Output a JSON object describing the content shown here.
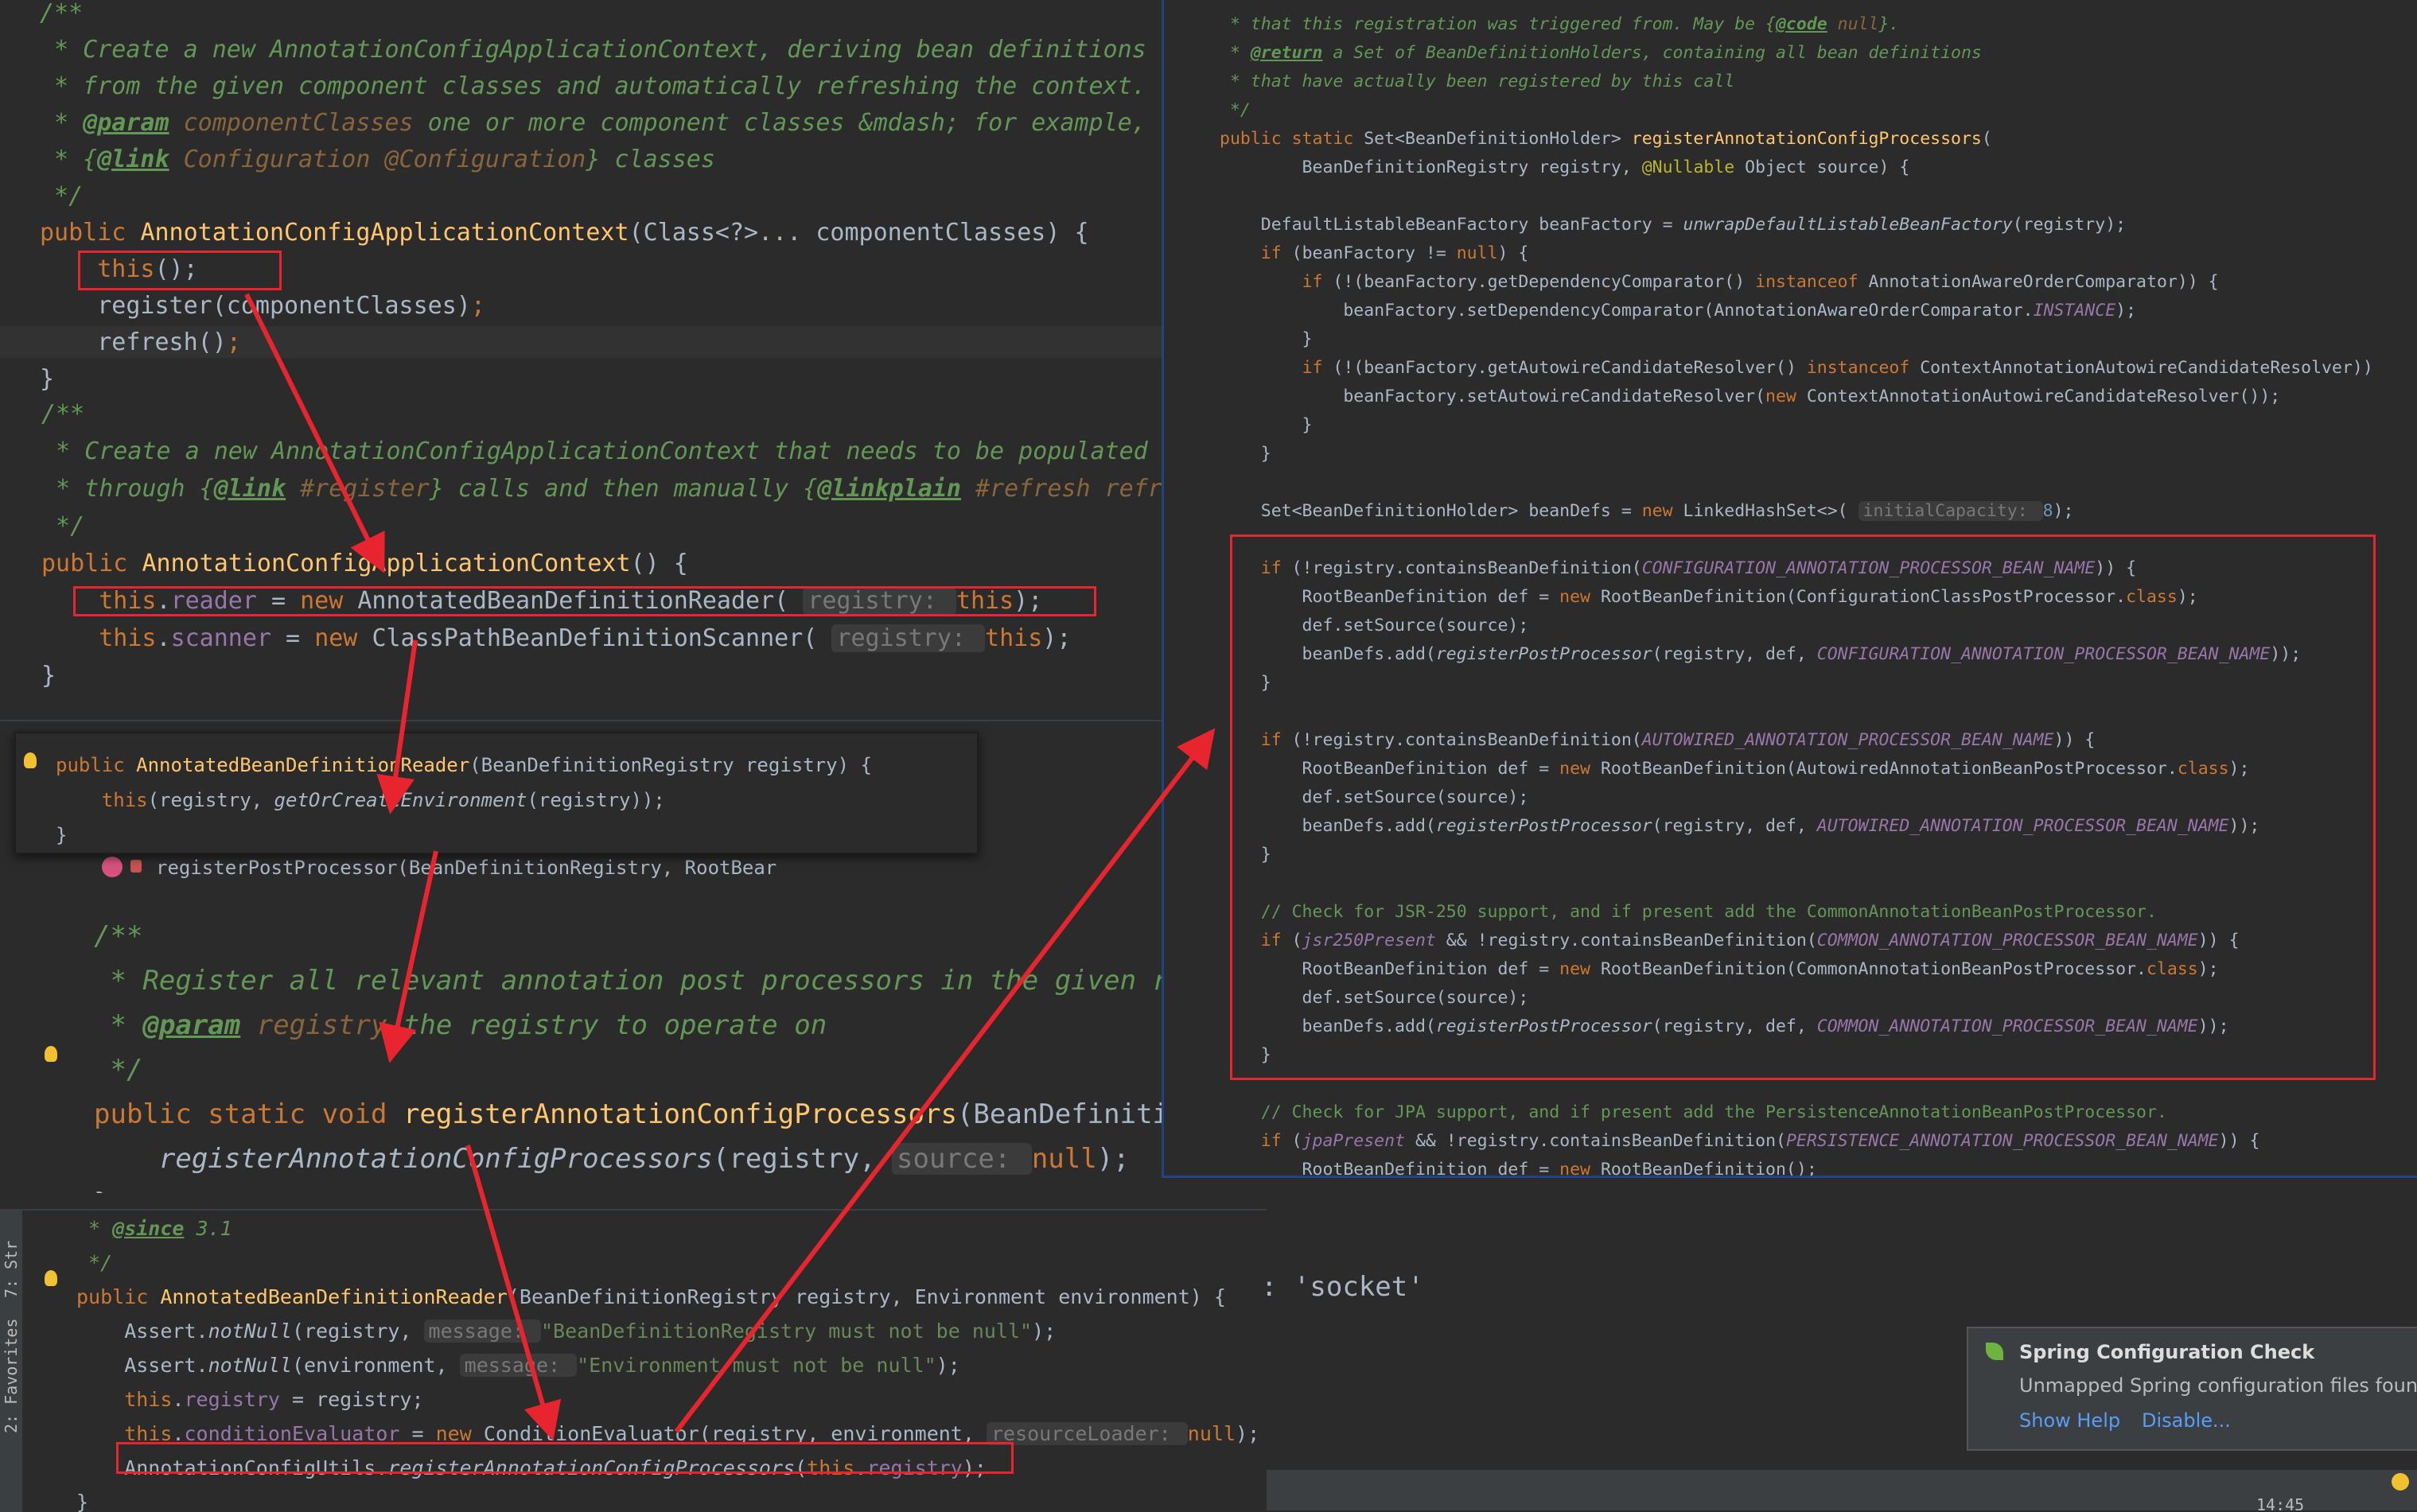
{
  "panel_a": {
    "lines": [
      [
        [
          "/**",
          "c"
        ]
      ],
      [
        [
          " * Create a new AnnotationConfigApplicationContext, deriving bean definitions",
          "c"
        ]
      ],
      [
        [
          " * from the given component classes and automatically refreshing the context.",
          "c"
        ]
      ],
      [
        [
          " * ",
          "c"
        ],
        [
          "@param",
          "ct"
        ],
        [
          " componentClasses",
          "ctag"
        ],
        [
          " one or more component classes &mdash; for example,",
          "c"
        ]
      ],
      [
        [
          " * {",
          "c"
        ],
        [
          "@link",
          "ct"
        ],
        [
          " Configuration @Configuration",
          "ctag"
        ],
        [
          "} classes",
          "c"
        ]
      ],
      [
        [
          " */",
          "c"
        ]
      ],
      [
        [
          "public ",
          "kw"
        ],
        [
          "AnnotationConfigApplicationContext",
          "fn"
        ],
        [
          "(Class<?>... componentClasses) {",
          ""
        ]
      ],
      [
        [
          "    ",
          ""
        ],
        [
          "this",
          "kw"
        ],
        [
          "();",
          ""
        ]
      ],
      [
        [
          "    register(componentClasses)",
          ""
        ],
        [
          ";",
          "kw"
        ]
      ],
      [
        [
          "    refresh()",
          ""
        ],
        [
          ";",
          "kw"
        ]
      ],
      [
        [
          "}",
          ""
        ]
      ]
    ]
  },
  "panel_b": {
    "lines": [
      [
        [
          "/**",
          "c"
        ]
      ],
      [
        [
          " * Create a new AnnotationConfigApplicationContext that needs to be populated",
          "c"
        ]
      ],
      [
        [
          " * through {",
          "c"
        ],
        [
          "@link",
          "ct"
        ],
        [
          " #register",
          "ctag"
        ],
        [
          "} calls and then manually {",
          "c"
        ],
        [
          "@linkplain",
          "ct"
        ],
        [
          " #refresh refr",
          "ctag"
        ]
      ],
      [
        [
          " */",
          "c"
        ]
      ],
      [
        [
          "public ",
          "kw"
        ],
        [
          "AnnotationConfigApplicationContext",
          "fn"
        ],
        [
          "() {",
          ""
        ]
      ],
      [
        [
          "    ",
          ""
        ],
        [
          "this",
          "kw"
        ],
        [
          ".",
          ""
        ],
        [
          "reader",
          "fld"
        ],
        [
          " = ",
          ""
        ],
        [
          "new ",
          "kw"
        ],
        [
          "AnnotatedBeanDefinitionReader( ",
          ""
        ],
        [
          "registry: ",
          "hint"
        ],
        [
          "this",
          "kw"
        ],
        [
          ");",
          ""
        ]
      ],
      [
        [
          "    ",
          ""
        ],
        [
          "this",
          "kw"
        ],
        [
          ".",
          ""
        ],
        [
          "scanner",
          "fld"
        ],
        [
          " = ",
          ""
        ],
        [
          "new ",
          "kw"
        ],
        [
          "ClassPathBeanDefinitionScanner( ",
          ""
        ],
        [
          "registry: ",
          "hint"
        ],
        [
          "this",
          "kw"
        ],
        [
          ");",
          ""
        ]
      ],
      [
        [
          "}",
          ""
        ]
      ]
    ]
  },
  "panel_c": {
    "lines": [
      [
        [
          "public ",
          "kw"
        ],
        [
          "AnnotatedBeanDefinitionReader",
          "fn"
        ],
        [
          "(BeanDefinitionRegistry registry) {",
          ""
        ]
      ],
      [
        [
          "    ",
          ""
        ],
        [
          "this",
          "kw"
        ],
        [
          "(registry, ",
          ""
        ],
        [
          "getOrCreateEnvironment",
          "ital"
        ],
        [
          "(registry));",
          ""
        ]
      ],
      [
        [
          "}",
          ""
        ]
      ]
    ],
    "structure_item": "registerPostProcessor(BeanDefinitionRegistry, RootBear"
  },
  "panel_d": {
    "lines": [
      [
        [
          "/**",
          "c"
        ]
      ],
      [
        [
          " * Register all relevant annotation post processors in the given re",
          "c"
        ]
      ],
      [
        [
          " * ",
          "c"
        ],
        [
          "@param",
          "ct"
        ],
        [
          " registry",
          "ctag"
        ],
        [
          " the registry to operate on",
          "c"
        ]
      ],
      [
        [
          " */",
          "c"
        ]
      ],
      [
        [
          "public static void ",
          "kw"
        ],
        [
          "registerAnnotationConfigProcessors",
          "fn"
        ],
        [
          "(BeanDefinitio",
          ""
        ]
      ],
      [
        [
          "    ",
          ""
        ],
        [
          "registerAnnotationConfigProcessors",
          "ital"
        ],
        [
          "(registry, ",
          ""
        ],
        [
          "source: ",
          "hint"
        ],
        [
          "null",
          "kw"
        ],
        [
          ");",
          ""
        ]
      ],
      [
        [
          "}",
          ""
        ]
      ]
    ]
  },
  "panel_e": {
    "lines": [
      [
        [
          " * ",
          "c"
        ],
        [
          "@since",
          "ct"
        ],
        [
          " 3.1",
          "c"
        ]
      ],
      [
        [
          " */",
          "c"
        ]
      ],
      [
        [
          "public ",
          "kw"
        ],
        [
          "AnnotatedBeanDefinitionReader",
          "fn"
        ],
        [
          "(BeanDefinitionRegistry registry, Environment environment) {",
          ""
        ]
      ],
      [
        [
          "    Assert.",
          ""
        ],
        [
          "notNull",
          "ital"
        ],
        [
          "(registry, ",
          ""
        ],
        [
          "message: ",
          "hint"
        ],
        [
          "\"BeanDefinitionRegistry must not be null\"",
          "str"
        ],
        [
          ");",
          ""
        ]
      ],
      [
        [
          "    Assert.",
          ""
        ],
        [
          "notNull",
          "ital"
        ],
        [
          "(environment, ",
          ""
        ],
        [
          "message: ",
          "hint"
        ],
        [
          "\"Environment must not be null\"",
          "str"
        ],
        [
          ");",
          ""
        ]
      ],
      [
        [
          "    ",
          ""
        ],
        [
          "this",
          "kw"
        ],
        [
          ".",
          ""
        ],
        [
          "registry",
          "fld"
        ],
        [
          " = registry;",
          ""
        ]
      ],
      [
        [
          "    ",
          ""
        ],
        [
          "this",
          "kw"
        ],
        [
          ".",
          ""
        ],
        [
          "conditionEvaluator",
          "fld"
        ],
        [
          " = ",
          ""
        ],
        [
          "new ",
          "kw"
        ],
        [
          "ConditionEvaluator(registry, environment, ",
          ""
        ],
        [
          "resourceLoader: ",
          "hint"
        ],
        [
          "null",
          "kw"
        ],
        [
          ");",
          ""
        ]
      ],
      [
        [
          "    AnnotationConfigUtils.",
          ""
        ],
        [
          "registerAnnotationConfigProcessors",
          "ital"
        ],
        [
          "(",
          ""
        ],
        [
          "this",
          "kw"
        ],
        [
          ".",
          ""
        ],
        [
          "registry",
          "fld"
        ],
        [
          ");",
          ""
        ]
      ],
      [
        [
          "}",
          ""
        ]
      ]
    ]
  },
  "panel_f": {
    "lines": [
      [
        [
          " * that this registration was triggered from. May be {",
          "c"
        ],
        [
          "@code",
          "ct"
        ],
        [
          " null",
          "ctag"
        ],
        [
          "}.",
          "c"
        ]
      ],
      [
        [
          " * ",
          "c"
        ],
        [
          "@return",
          "ct"
        ],
        [
          " a Set of BeanDefinitionHolders, containing all bean definitions",
          "c"
        ]
      ],
      [
        [
          " * that have actually been registered by this call",
          "c"
        ]
      ],
      [
        [
          " */",
          "c"
        ]
      ],
      [
        [
          "public static ",
          "kw"
        ],
        [
          "Set<BeanDefinitionHolder> ",
          ""
        ],
        [
          "registerAnnotationConfigProcessors",
          "fn"
        ],
        [
          "(",
          ""
        ]
      ],
      [
        [
          "        BeanDefinitionRegistry registry, ",
          ""
        ],
        [
          "@Nullable ",
          "ann"
        ],
        [
          "Object source) {",
          ""
        ]
      ],
      [
        [
          "",
          ""
        ]
      ],
      [
        [
          "    DefaultListableBeanFactory beanFactory = ",
          ""
        ],
        [
          "unwrapDefaultListableBeanFactory",
          "ital"
        ],
        [
          "(registry);",
          ""
        ]
      ],
      [
        [
          "    ",
          ""
        ],
        [
          "if ",
          "kw"
        ],
        [
          "(beanFactory != ",
          ""
        ],
        [
          "null",
          "kw"
        ],
        [
          ") {",
          ""
        ]
      ],
      [
        [
          "        ",
          ""
        ],
        [
          "if ",
          "kw"
        ],
        [
          "(!(beanFactory.getDependencyComparator() ",
          ""
        ],
        [
          "instanceof ",
          "kw"
        ],
        [
          "AnnotationAwareOrderComparator)) {",
          ""
        ]
      ],
      [
        [
          "            beanFactory.setDependencyComparator(AnnotationAwareOrderComparator.",
          ""
        ],
        [
          "INSTANCE",
          "cst"
        ],
        [
          ");",
          ""
        ]
      ],
      [
        [
          "        }",
          ""
        ]
      ],
      [
        [
          "        ",
          ""
        ],
        [
          "if ",
          "kw"
        ],
        [
          "(!(beanFactory.getAutowireCandidateResolver() ",
          ""
        ],
        [
          "instanceof ",
          "kw"
        ],
        [
          "ContextAnnotationAutowireCandidateResolver))",
          ""
        ]
      ],
      [
        [
          "            beanFactory.setAutowireCandidateResolver(",
          ""
        ],
        [
          "new ",
          "kw"
        ],
        [
          "ContextAnnotationAutowireCandidateResolver());",
          ""
        ]
      ],
      [
        [
          "        }",
          ""
        ]
      ],
      [
        [
          "    }",
          ""
        ]
      ],
      [
        [
          "",
          ""
        ]
      ],
      [
        [
          "    Set<BeanDefinitionHolder> beanDefs = ",
          ""
        ],
        [
          "new ",
          "kw"
        ],
        [
          "LinkedHashSet<>( ",
          ""
        ],
        [
          "initialCapacity: ",
          "hint"
        ],
        [
          "8",
          "num"
        ],
        [
          ");",
          ""
        ]
      ],
      [
        [
          "",
          ""
        ]
      ],
      [
        [
          "    ",
          ""
        ],
        [
          "if ",
          "kw"
        ],
        [
          "(!registry.containsBeanDefinition(",
          ""
        ],
        [
          "CONFIGURATION_ANNOTATION_PROCESSOR_BEAN_NAME",
          "cst"
        ],
        [
          ")) {",
          ""
        ]
      ],
      [
        [
          "        RootBeanDefinition def = ",
          ""
        ],
        [
          "new ",
          "kw"
        ],
        [
          "RootBeanDefinition(ConfigurationClassPostProcessor.",
          ""
        ],
        [
          "class",
          "kw"
        ],
        [
          ");",
          ""
        ]
      ],
      [
        [
          "        def.setSource(source);",
          ""
        ]
      ],
      [
        [
          "        beanDefs.add(",
          ""
        ],
        [
          "registerPostProcessor",
          "ital"
        ],
        [
          "(registry, def, ",
          ""
        ],
        [
          "CONFIGURATION_ANNOTATION_PROCESSOR_BEAN_NAME",
          "cst"
        ],
        [
          "));",
          ""
        ]
      ],
      [
        [
          "    }",
          ""
        ]
      ],
      [
        [
          "",
          ""
        ]
      ],
      [
        [
          "    ",
          ""
        ],
        [
          "if ",
          "kw"
        ],
        [
          "(!registry.containsBeanDefinition(",
          ""
        ],
        [
          "AUTOWIRED_ANNOTATION_PROCESSOR_BEAN_NAME",
          "cst"
        ],
        [
          ")) {",
          ""
        ]
      ],
      [
        [
          "        RootBeanDefinition def = ",
          ""
        ],
        [
          "new ",
          "kw"
        ],
        [
          "RootBeanDefinition(AutowiredAnnotationBeanPostProcessor.",
          ""
        ],
        [
          "class",
          "kw"
        ],
        [
          ");",
          ""
        ]
      ],
      [
        [
          "        def.setSource(source);",
          ""
        ]
      ],
      [
        [
          "        beanDefs.add(",
          ""
        ],
        [
          "registerPostProcessor",
          "ital"
        ],
        [
          "(registry, def, ",
          ""
        ],
        [
          "AUTOWIRED_ANNOTATION_PROCESSOR_BEAN_NAME",
          "cst"
        ],
        [
          "));",
          ""
        ]
      ],
      [
        [
          "    }",
          ""
        ]
      ],
      [
        [
          "",
          ""
        ]
      ],
      [
        [
          "    // Check for JSR-250 support, and if present add the CommonAnnotationBeanPostProcessor.",
          "cmt"
        ]
      ],
      [
        [
          "    ",
          ""
        ],
        [
          "if ",
          "kw"
        ],
        [
          "(",
          ""
        ],
        [
          "jsr250Present",
          "cst"
        ],
        [
          " && !registry.containsBeanDefinition(",
          ""
        ],
        [
          "COMMON_ANNOTATION_PROCESSOR_BEAN_NAME",
          "cst"
        ],
        [
          ")) {",
          ""
        ]
      ],
      [
        [
          "        RootBeanDefinition def = ",
          ""
        ],
        [
          "new ",
          "kw"
        ],
        [
          "RootBeanDefinition(CommonAnnotationBeanPostProcessor.",
          ""
        ],
        [
          "class",
          "kw"
        ],
        [
          ");",
          ""
        ]
      ],
      [
        [
          "        def.setSource(source);",
          ""
        ]
      ],
      [
        [
          "        beanDefs.add(",
          ""
        ],
        [
          "registerPostProcessor",
          "ital"
        ],
        [
          "(registry, def, ",
          ""
        ],
        [
          "COMMON_ANNOTATION_PROCESSOR_BEAN_NAME",
          "cst"
        ],
        [
          "));",
          ""
        ]
      ],
      [
        [
          "    }",
          ""
        ]
      ],
      [
        [
          "",
          ""
        ]
      ],
      [
        [
          "    // Check for JPA support, and if present add the PersistenceAnnotationBeanPostProcessor.",
          "cmt"
        ]
      ],
      [
        [
          "    ",
          ""
        ],
        [
          "if ",
          "kw"
        ],
        [
          "(",
          ""
        ],
        [
          "jpaPresent",
          "cst"
        ],
        [
          " && !registry.containsBeanDefinition(",
          ""
        ],
        [
          "PERSISTENCE_ANNOTATION_PROCESSOR_BEAN_NAME",
          "cst"
        ],
        [
          ")) {",
          ""
        ]
      ],
      [
        [
          "        RootBeanDefinition def = ",
          ""
        ],
        [
          "new ",
          "kw"
        ],
        [
          "RootBeanDefinition();",
          ""
        ]
      ]
    ]
  },
  "background": {
    "socket_text": ": 'socket'",
    "tool_tab_structure": "7: Str",
    "tool_tab_favorites": "2: Favorites",
    "clock": "14:45"
  },
  "notification": {
    "title": "Spring Configuration Check",
    "message": "Unmapped Spring configuration files found.",
    "action_help": "Show Help",
    "action_disable": "Disable...",
    "accent": "#589df6"
  },
  "colors": {
    "highlight_box": "#e8242e",
    "arrow": "#e8242e"
  }
}
